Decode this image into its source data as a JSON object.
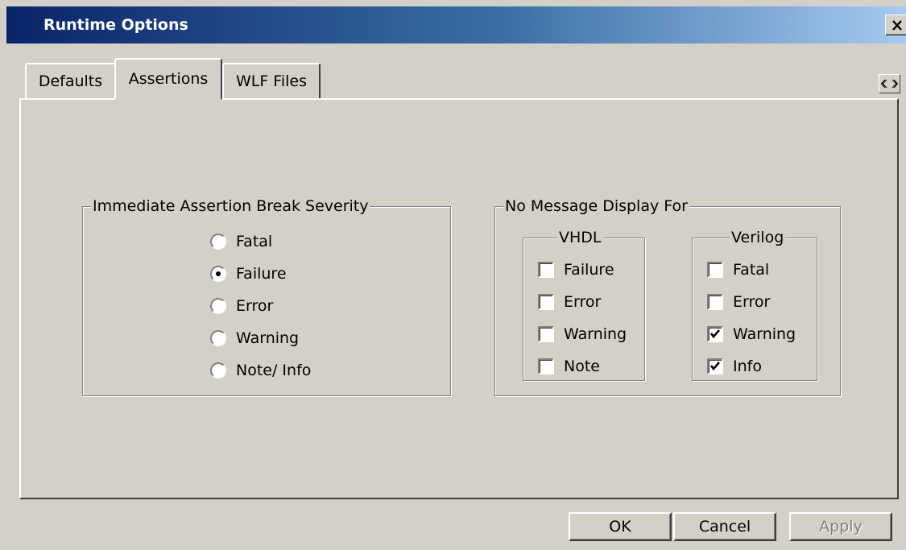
{
  "window": {
    "title": "Runtime Options"
  },
  "tabs": [
    {
      "label": "Defaults",
      "active": false
    },
    {
      "label": "Assertions",
      "active": true
    },
    {
      "label": "WLF Files",
      "active": false
    }
  ],
  "break_severity": {
    "legend": "Immediate Assertion Break Severity",
    "options": [
      {
        "label": "Fatal",
        "selected": false
      },
      {
        "label": "Failure",
        "selected": true
      },
      {
        "label": "Error",
        "selected": false
      },
      {
        "label": "Warning",
        "selected": false
      },
      {
        "label": "Note/ Info",
        "selected": false
      }
    ]
  },
  "no_message": {
    "legend": "No Message Display For",
    "vhdl": {
      "legend": "VHDL",
      "items": [
        {
          "label": "Failure",
          "checked": false
        },
        {
          "label": "Error",
          "checked": false
        },
        {
          "label": "Warning",
          "checked": false
        },
        {
          "label": "Note",
          "checked": false
        }
      ]
    },
    "verilog": {
      "legend": "Verilog",
      "items": [
        {
          "label": "Fatal",
          "checked": false
        },
        {
          "label": "Error",
          "checked": false
        },
        {
          "label": "Warning",
          "checked": true
        },
        {
          "label": "Info",
          "checked": true
        }
      ]
    }
  },
  "buttons": {
    "ok": "OK",
    "cancel": "Cancel",
    "apply": "Apply"
  },
  "icons": {
    "close": "close-icon",
    "tab_scroll_left": "arrow-left-icon",
    "tab_scroll_right": "arrow-right-icon",
    "checkmark": "checkmark-icon"
  }
}
